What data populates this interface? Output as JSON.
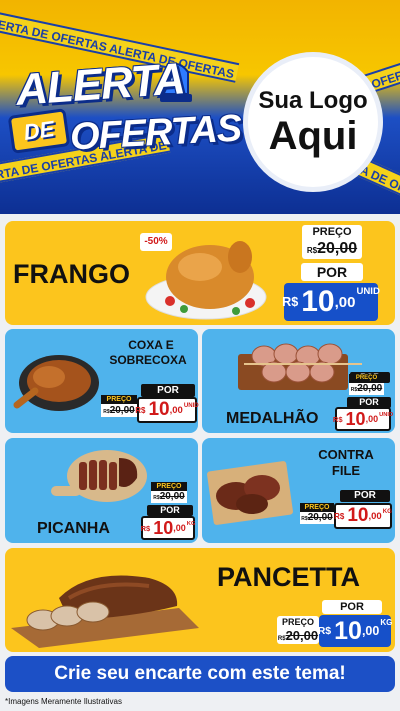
{
  "header": {
    "title_line1": "ALERTA",
    "title_de": "DE",
    "title_line2": "OFERTAS",
    "tape_text": "ALERTA DE OFERTAS ALERTA DE OFERTAS ALERTA DE OFERTAS",
    "logo_line1": "Sua Logo",
    "logo_line2": "Aqui"
  },
  "products": {
    "frango": {
      "name": "FRANGO",
      "discount": "-50%",
      "price_label": "PREÇO",
      "old_cur": "R$",
      "old_value": "20,00",
      "por": "POR",
      "cur": "R$",
      "int": "10",
      "cents": ",00",
      "unit": "UNID"
    },
    "coxa": {
      "name_line1": "COXA E",
      "name_line2": "SOBRECOXA",
      "price_label": "PREÇO",
      "old_cur": "R$",
      "old_value": "20,00",
      "por": "POR",
      "cur": "R$",
      "int": "10",
      "cents": ",00",
      "unit": "UNID"
    },
    "medalhao": {
      "name": "MEDALHÃO",
      "price_label": "PREÇO",
      "old_cur": "R$",
      "old_value": "20,00",
      "por": "POR",
      "cur": "R$",
      "int": "10",
      "cents": ",00",
      "unit": "UNID"
    },
    "picanha": {
      "name": "PICANHA",
      "price_label": "PREÇO",
      "old_cur": "R$",
      "old_value": "20,00",
      "por": "POR",
      "cur": "R$",
      "int": "10",
      "cents": ",00",
      "unit": "KG"
    },
    "contrafile": {
      "name_line1": "CONTRA",
      "name_line2": "FILE",
      "price_label": "PREÇO",
      "old_cur": "R$",
      "old_value": "20,00",
      "por": "POR",
      "cur": "R$",
      "int": "10",
      "cents": ",00",
      "unit": "KG"
    },
    "pancetta": {
      "name": "PANCETTA",
      "price_label": "PREÇO",
      "old_cur": "R$",
      "old_value": "20,00",
      "por": "POR",
      "cur": "R$",
      "int": "10",
      "cents": ",00",
      "unit": "KG"
    }
  },
  "cta_text": "Crie seu encarte com este tema!",
  "footnote": "*Imagens Meramente Ilustrativas",
  "colors": {
    "yellow": "#fcc51d",
    "blue": "#4fb3ec",
    "brand_blue": "#1c50c6",
    "price_red": "#d11a1a"
  }
}
